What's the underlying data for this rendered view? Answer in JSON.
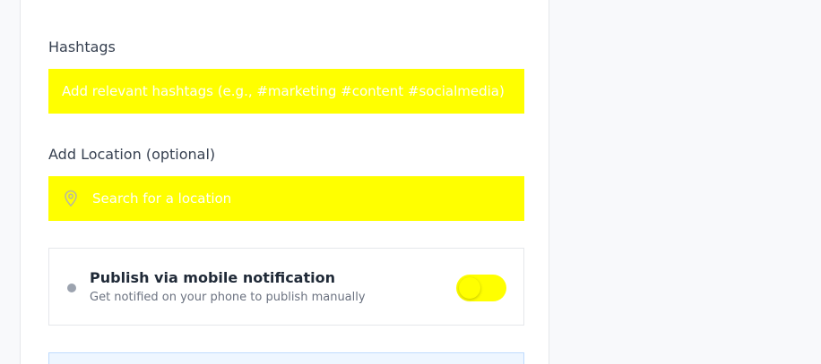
{
  "form": {
    "hashtags": {
      "label": "Hashtags",
      "placeholder": "Add relevant hashtags (e.g., #marketing #content #socialmedia)",
      "value": ""
    },
    "location": {
      "label": "Add Location (optional)",
      "placeholder": "Search for a location",
      "value": "",
      "icon": "map-pin-icon"
    },
    "mobile_notification": {
      "title": "Publish via mobile notification",
      "subtitle": "Get notified on your phone to publish manually",
      "enabled": true
    }
  },
  "colors": {
    "input_background": "#ffff00",
    "toggle_active": "#ffff00",
    "page_background": "#f8f9fb",
    "card_background": "#ffffff"
  }
}
